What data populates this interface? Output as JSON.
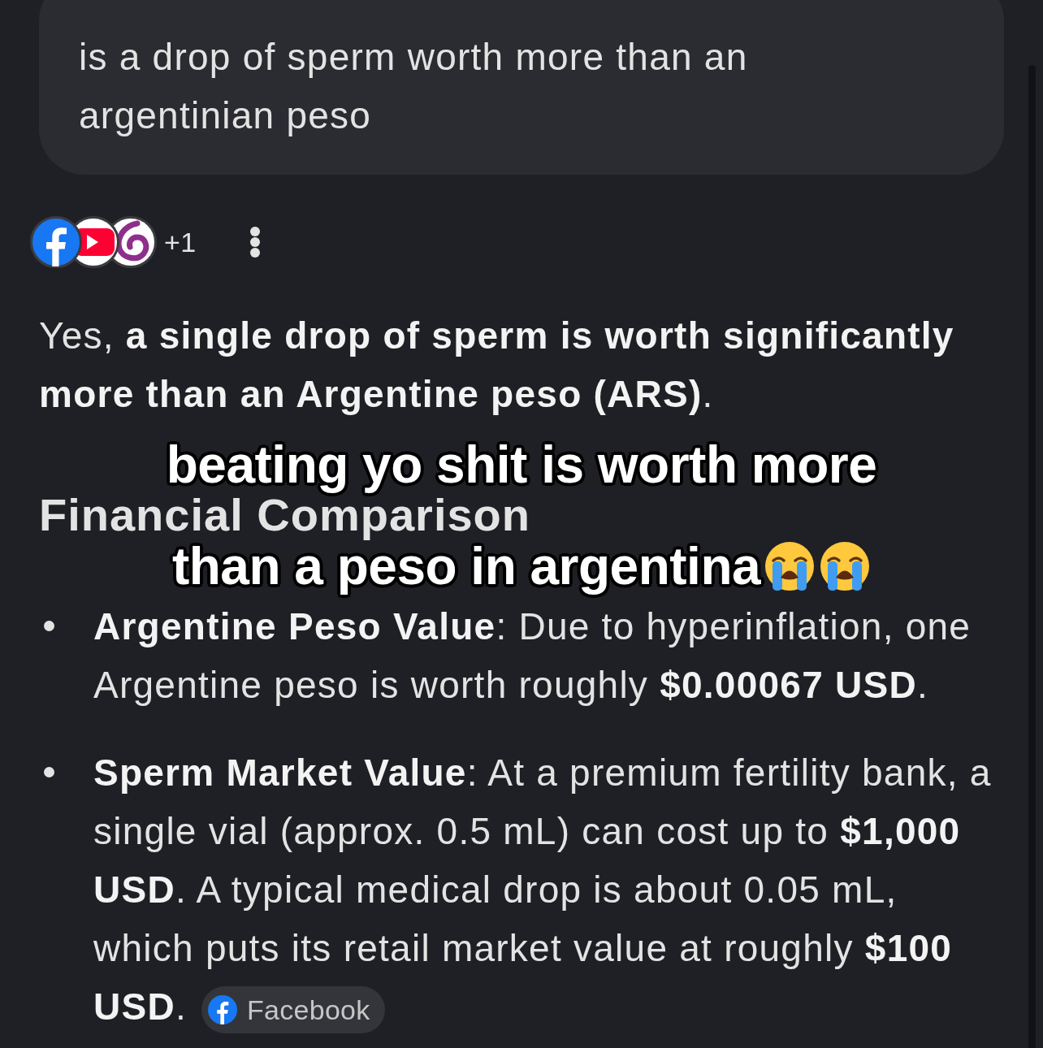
{
  "query": {
    "text": "is a drop of sperm worth more than an argentinian peso"
  },
  "sources": {
    "extra_count": "+1"
  },
  "answer": {
    "summary": "Yes, **a single drop of sperm is worth significantly more than an Argentine peso (ARS)**.",
    "heading": "Financial Comparison",
    "bullets": [
      {
        "text": "**Argentine Peso Value**: Due to hyperinflation, one Argentine peso is worth roughly **$0.00067 USD**."
      },
      {
        "text": "**Sperm Market Value**: At a premium fertility bank, a single vial (approx. 0.5 mL) can cost up to **$1,000 USD**. A typical medical drop is about 0.05 mL, which puts its retail market value at roughly **$100 USD**.",
        "source": {
          "label": "Facebook"
        }
      }
    ]
  },
  "overlay_caption": {
    "lines": [
      "beating yo shit is worth more",
      "than a peso in argentina"
    ]
  }
}
